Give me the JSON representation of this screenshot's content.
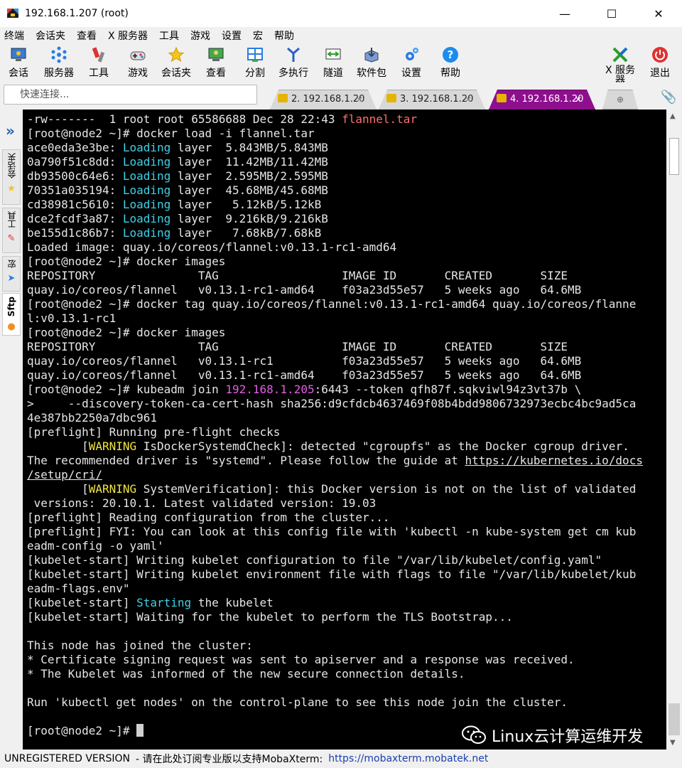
{
  "window": {
    "title": "192.168.1.207 (root)",
    "controls": [
      "—",
      "☐",
      "✕"
    ]
  },
  "menu": [
    "终端",
    "会话夹",
    "查看",
    "X 服务器",
    "工具",
    "游戏",
    "设置",
    "宏",
    "帮助"
  ],
  "toolbar": {
    "items": [
      {
        "label": "会话",
        "icon": "session-icon"
      },
      {
        "label": "服务器",
        "icon": "servers-icon"
      },
      {
        "label": "工具",
        "icon": "tools-icon"
      },
      {
        "label": "游戏",
        "icon": "games-icon"
      },
      {
        "label": "会话夹",
        "icon": "star-icon"
      },
      {
        "label": "查看",
        "icon": "view-icon"
      },
      {
        "label": "分割",
        "icon": "split-icon"
      },
      {
        "label": "多执行",
        "icon": "multiexec-icon"
      },
      {
        "label": "隧道",
        "icon": "tunnel-icon"
      },
      {
        "label": "软件包",
        "icon": "packages-icon"
      },
      {
        "label": "设置",
        "icon": "gear-icon"
      },
      {
        "label": "帮助",
        "icon": "help-icon"
      }
    ],
    "xserver_label_1": "X 服务",
    "xserver_label_2": "器",
    "exit_label": "退出"
  },
  "quick_connect": {
    "placeholder": "快速连接..."
  },
  "tabs": [
    {
      "label": "2. 192.168.1.20",
      "active": false
    },
    {
      "label": "3. 192.168.1.20",
      "active": false
    },
    {
      "label": "4. 192.168.1.20",
      "active": true
    }
  ],
  "sidebar": {
    "tabs": [
      "会话夹",
      "工具",
      "宏",
      "Sftp"
    ]
  },
  "terminal": {
    "lines": [
      [
        {
          "t": "-rw-------  1 root root 65586688 Dec 28 22:43 "
        },
        {
          "t": "flannel.tar",
          "c": "red"
        }
      ],
      [
        {
          "t": "[root@node2 ~]# docker load -i flannel.tar"
        }
      ],
      [
        {
          "t": "ace0eda3e3be: "
        },
        {
          "t": "Loading",
          "c": "cyan"
        },
        {
          "t": " layer  5.843MB/5.843MB"
        }
      ],
      [
        {
          "t": "0a790f51c8dd: "
        },
        {
          "t": "Loading",
          "c": "cyan"
        },
        {
          "t": " layer  11.42MB/11.42MB"
        }
      ],
      [
        {
          "t": "db93500c64e6: "
        },
        {
          "t": "Loading",
          "c": "cyan"
        },
        {
          "t": " layer  2.595MB/2.595MB"
        }
      ],
      [
        {
          "t": "70351a035194: "
        },
        {
          "t": "Loading",
          "c": "cyan"
        },
        {
          "t": " layer  45.68MB/45.68MB"
        }
      ],
      [
        {
          "t": "cd38981c5610: "
        },
        {
          "t": "Loading",
          "c": "cyan"
        },
        {
          "t": " layer   5.12kB/5.12kB"
        }
      ],
      [
        {
          "t": "dce2fcdf3a87: "
        },
        {
          "t": "Loading",
          "c": "cyan"
        },
        {
          "t": " layer  9.216kB/9.216kB"
        }
      ],
      [
        {
          "t": "be155d1c86b7: "
        },
        {
          "t": "Loading",
          "c": "cyan"
        },
        {
          "t": " layer   7.68kB/7.68kB"
        }
      ],
      [
        {
          "t": "Loaded image: quay.io/coreos/flannel:v0.13.1-rc1-amd64"
        }
      ],
      [
        {
          "t": "[root@node2 ~]# docker images"
        }
      ],
      [
        {
          "t": "REPOSITORY               TAG                  IMAGE ID       CREATED       SIZE"
        }
      ],
      [
        {
          "t": "quay.io/coreos/flannel   v0.13.1-rc1-amd64    f03a23d55e57   5 weeks ago   64.6MB"
        }
      ],
      [
        {
          "t": "[root@node2 ~]# docker tag quay.io/coreos/flannel:v0.13.1-rc1-amd64 quay.io/coreos/flanne"
        }
      ],
      [
        {
          "t": "l:v0.13.1-rc1"
        }
      ],
      [
        {
          "t": "[root@node2 ~]# docker images"
        }
      ],
      [
        {
          "t": "REPOSITORY               TAG                  IMAGE ID       CREATED       SIZE"
        }
      ],
      [
        {
          "t": "quay.io/coreos/flannel   v0.13.1-rc1          f03a23d55e57   5 weeks ago   64.6MB"
        }
      ],
      [
        {
          "t": "quay.io/coreos/flannel   v0.13.1-rc1-amd64    f03a23d55e57   5 weeks ago   64.6MB"
        }
      ],
      [
        {
          "t": "[root@node2 ~]# kubeadm join "
        },
        {
          "t": "192.168.1.205",
          "c": "magenta"
        },
        {
          "t": ":6443 --token qfh87f.sqkviwl94z3vt37b \\"
        }
      ],
      [
        {
          "t": ">     --discovery-token-ca-cert-hash sha256:d9cfdcb4637469f08b4bdd9806732973ecbc4bc9ad5ca"
        }
      ],
      [
        {
          "t": "4e387bb2250a7dbc961"
        }
      ],
      [
        {
          "t": "[preflight] Running pre-flight checks"
        }
      ],
      [
        {
          "t": "        ["
        },
        {
          "t": "WARNING",
          "c": "yellow"
        },
        {
          "t": " IsDockerSystemdCheck]: detected \"cgroupfs\" as the Docker cgroup driver."
        }
      ],
      [
        {
          "t": "The recommended driver is \"systemd\". Please follow the guide at "
        },
        {
          "t": "https://kubernetes.io/docs",
          "c": "link"
        }
      ],
      [
        {
          "t": "/setup/cri/",
          "c": "link"
        }
      ],
      [
        {
          "t": "        ["
        },
        {
          "t": "WARNING",
          "c": "yellow"
        },
        {
          "t": " SystemVerification]: this Docker version is not on the list of validated"
        }
      ],
      [
        {
          "t": " versions: 20.10.1. Latest validated version: 19.03"
        }
      ],
      [
        {
          "t": "[preflight] Reading configuration from the cluster..."
        }
      ],
      [
        {
          "t": "[preflight] FYI: You can look at this config file with 'kubectl -n kube-system get cm kub"
        }
      ],
      [
        {
          "t": "eadm-config -o yaml'"
        }
      ],
      [
        {
          "t": "[kubelet-start] Writing kubelet configuration to file \"/var/lib/kubelet/config.yaml\""
        }
      ],
      [
        {
          "t": "[kubelet-start] Writing kubelet environment file with flags to file \"/var/lib/kubelet/kub"
        }
      ],
      [
        {
          "t": "eadm-flags.env\""
        }
      ],
      [
        {
          "t": "[kubelet-start] "
        },
        {
          "t": "Starting",
          "c": "cyan"
        },
        {
          "t": " the kubelet"
        }
      ],
      [
        {
          "t": "[kubelet-start] Waiting for the kubelet to perform the TLS Bootstrap..."
        }
      ],
      [
        {
          "t": ""
        }
      ],
      [
        {
          "t": "This node has joined the cluster:"
        }
      ],
      [
        {
          "t": "* Certificate signing request was sent to apiserver and a response was received."
        }
      ],
      [
        {
          "t": "* The Kubelet was informed of the new secure connection details."
        }
      ],
      [
        {
          "t": ""
        }
      ],
      [
        {
          "t": "Run 'kubectl get nodes' on the control-plane to see this node join the cluster."
        }
      ],
      [
        {
          "t": ""
        }
      ],
      [
        {
          "t": "[root@node2 ~]# "
        }
      ]
    ]
  },
  "watermark": "Linux云计算运维开发",
  "status": {
    "unregistered": "UNREGISTERED VERSION",
    "message": "-  请在此处订阅专业版以支持MobaXterm:",
    "link": "https://mobaxterm.mobatek.net"
  },
  "colors": {
    "terminal_bg": "#000000",
    "terminal_fg": "#e6e6e6",
    "red": "#ff6e6e",
    "cyan": "#3fd1e8",
    "magenta": "#e45ee4",
    "yellow": "#f2e640",
    "active_tab": "#8e0f8e"
  }
}
